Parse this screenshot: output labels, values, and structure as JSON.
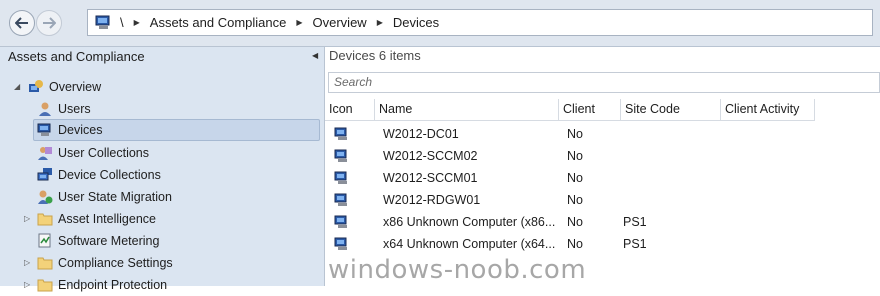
{
  "address_bar": {
    "root_sep": "\\",
    "crumbs": [
      "Assets and Compliance",
      "Overview",
      "Devices"
    ]
  },
  "nav": {
    "title": "Assets and Compliance",
    "items": [
      {
        "label": "Overview",
        "icon": "overview-icon"
      },
      {
        "label": "Users",
        "icon": "user-icon"
      },
      {
        "label": "Devices",
        "icon": "computer-icon"
      },
      {
        "label": "User Collections",
        "icon": "user-collection-icon"
      },
      {
        "label": "Device Collections",
        "icon": "device-collection-icon"
      },
      {
        "label": "User State Migration",
        "icon": "migration-icon"
      },
      {
        "label": "Asset Intelligence",
        "icon": "folder-icon"
      },
      {
        "label": "Software Metering",
        "icon": "metering-icon"
      },
      {
        "label": "Compliance Settings",
        "icon": "folder-icon"
      },
      {
        "label": "Endpoint Protection",
        "icon": "folder-icon"
      }
    ]
  },
  "main": {
    "title": "Devices 6 items",
    "search_placeholder": "Search",
    "columns": [
      "Icon",
      "Name",
      "Client",
      "Site Code",
      "Client Activity"
    ],
    "rows": [
      {
        "name": "W2012-DC01",
        "client": "No",
        "site_code": "",
        "activity": ""
      },
      {
        "name": "W2012-SCCM02",
        "client": "No",
        "site_code": "",
        "activity": ""
      },
      {
        "name": "W2012-SCCM01",
        "client": "No",
        "site_code": "",
        "activity": ""
      },
      {
        "name": "W2012-RDGW01",
        "client": "No",
        "site_code": "",
        "activity": ""
      },
      {
        "name": "x86 Unknown Computer (x86...",
        "client": "No",
        "site_code": "PS1",
        "activity": ""
      },
      {
        "name": "x64 Unknown Computer (x64...",
        "client": "No",
        "site_code": "PS1",
        "activity": ""
      }
    ]
  },
  "watermark": "windows-noob.com",
  "colors": {
    "selected": "#c7d6ea",
    "nav_bg": "#dbe5f1",
    "toolbar_bg": "#dfe6ef"
  }
}
